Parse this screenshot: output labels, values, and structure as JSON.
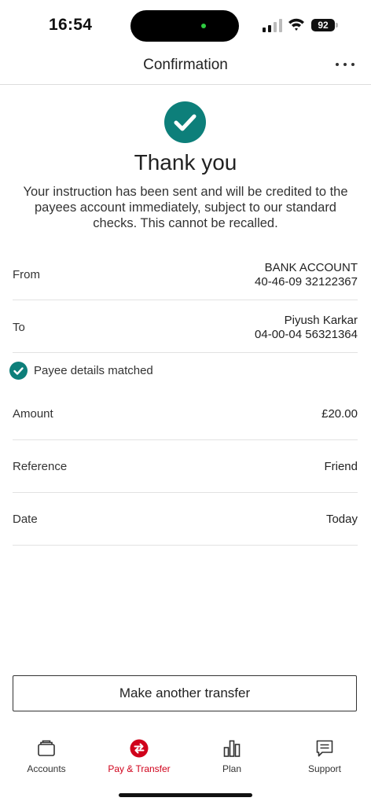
{
  "status": {
    "time": "16:54",
    "battery": "92"
  },
  "header": {
    "title": "Confirmation"
  },
  "confirmation": {
    "title": "Thank you",
    "message": "Your instruction has been sent and will be credited to the payees account immediately, subject to our standard checks.  This cannot be recalled."
  },
  "details": {
    "from": {
      "label": "From",
      "line1": "BANK ACCOUNT",
      "line2": "40-46-09 32122367"
    },
    "to": {
      "label": "To",
      "line1": "Piyush Karkar",
      "line2": "04-00-04 56321364"
    },
    "payee_match": "Payee details matched",
    "amount": {
      "label": "Amount",
      "value": "£20.00"
    },
    "reference": {
      "label": "Reference",
      "value": "Friend"
    },
    "date": {
      "label": "Date",
      "value": "Today"
    }
  },
  "actions": {
    "make_another": "Make another transfer"
  },
  "tabs": [
    {
      "label": "Accounts",
      "icon": "wallet-icon"
    },
    {
      "label": "Pay & Transfer",
      "icon": "transfer-arrows-icon"
    },
    {
      "label": "Plan",
      "icon": "bar-chart-icon"
    },
    {
      "label": "Support",
      "icon": "chat-icon"
    }
  ],
  "colors": {
    "accent": "#0d7f7a",
    "active_tab": "#d0021b"
  }
}
